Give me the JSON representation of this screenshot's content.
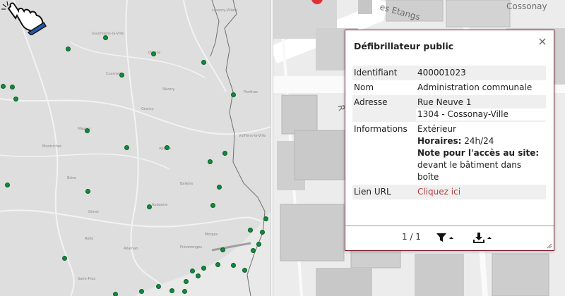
{
  "overview_map": {
    "places": [
      {
        "name": "Goumoens-la-Ville"
      },
      {
        "name": "Oulens"
      },
      {
        "name": "Cuarnens"
      },
      {
        "name": "Sévery"
      },
      {
        "name": "Grancy"
      },
      {
        "name": "Mauraz"
      },
      {
        "name": "Montricher"
      },
      {
        "name": "Apples"
      },
      {
        "name": "Bière"
      },
      {
        "name": "Ballens"
      },
      {
        "name": "Gimel"
      },
      {
        "name": "Aubonne"
      },
      {
        "name": "Rolle"
      },
      {
        "name": "Morges"
      },
      {
        "name": "Allaman"
      },
      {
        "name": "Préverenges"
      },
      {
        "name": "Saint-Prex"
      },
      {
        "name": "Lussery-Villars"
      },
      {
        "name": "Penthaz"
      },
      {
        "name": "Vufflens-la-Ville"
      }
    ]
  },
  "detail_map": {
    "streets": [
      {
        "name": "es Etangs"
      },
      {
        "name": "R"
      }
    ],
    "town_label": "Cossonay"
  },
  "popup": {
    "title": "Défibrillateur public",
    "close_label": "×",
    "rows": {
      "id_key": "Identifiant",
      "id_value": "400001023",
      "name_key": "Nom",
      "name_value": "Administration communale",
      "address_key": "Adresse",
      "address_line1": "Rue Neuve 1",
      "address_line2": "1304 - Cossonay-Ville",
      "info_key": "Informations",
      "info_location": "Extérieur",
      "hours_label": "Horaires:",
      "hours_value": " 24h/24",
      "access_label": "Note pour l'accès au site:",
      "access_line1": "devant le bâtiment dans",
      "access_line2": "boîte",
      "url_key": "Lien URL",
      "url_link": "Cliquez ici"
    },
    "footer": {
      "pager": "1 / 1"
    }
  },
  "colors": {
    "marker": "#128a3c",
    "popup_border": "#7c2232",
    "link": "#b04040"
  }
}
